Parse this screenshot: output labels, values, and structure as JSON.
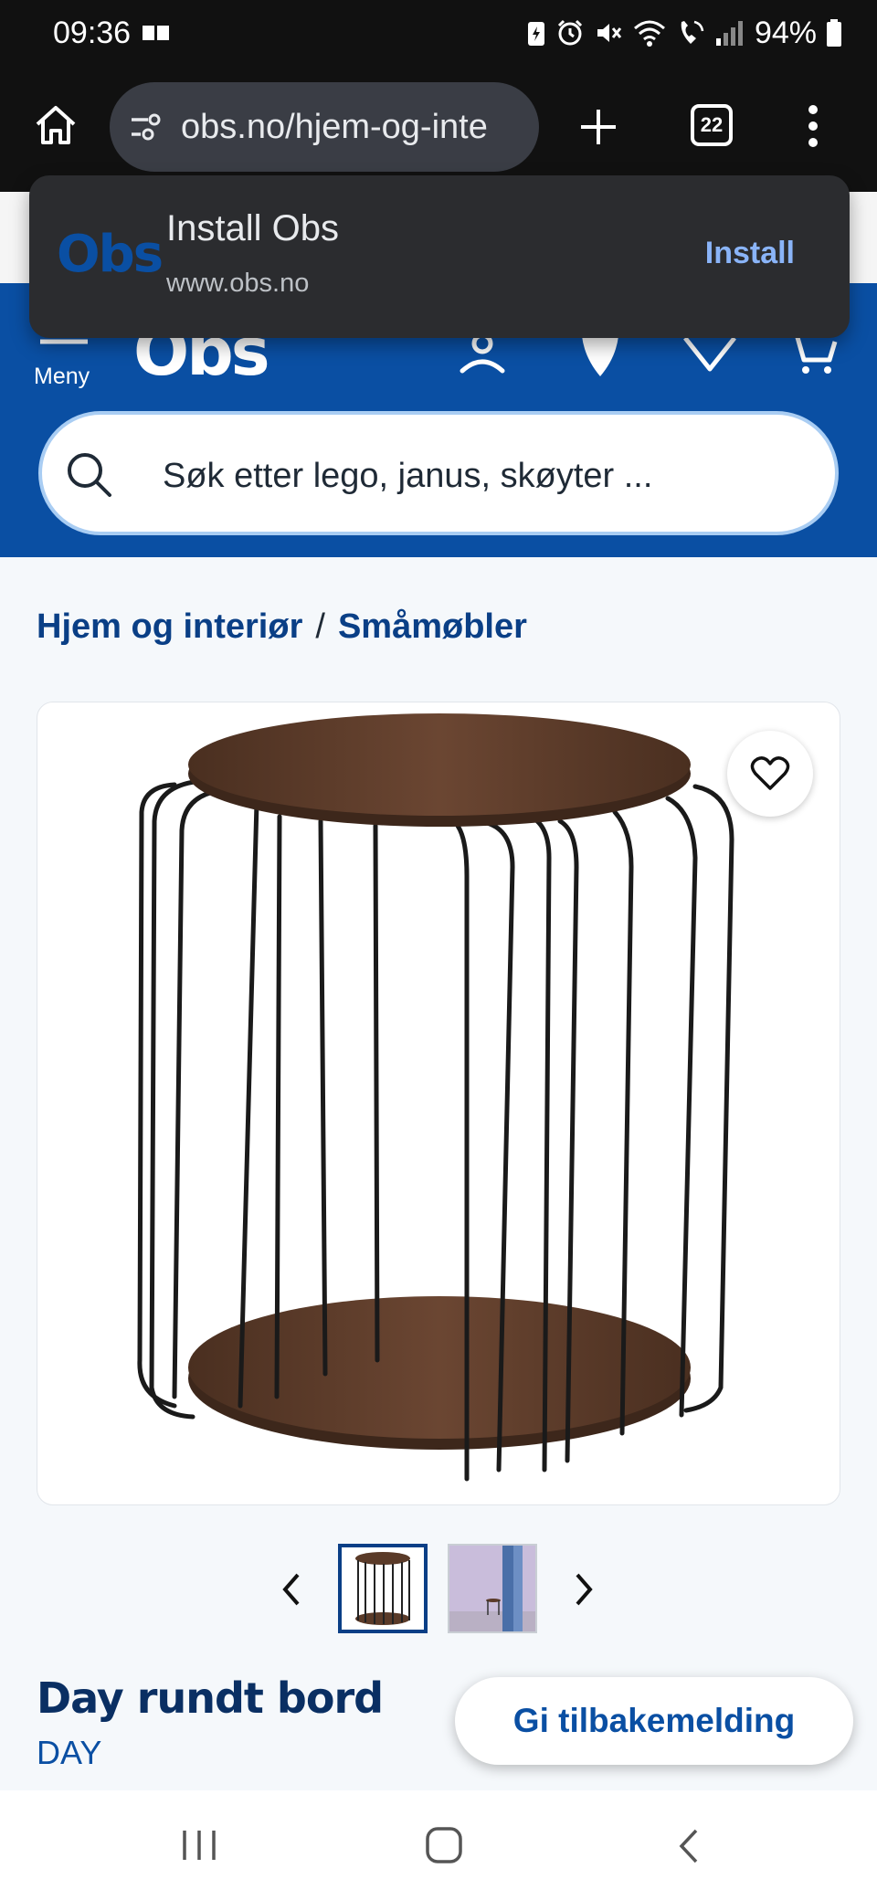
{
  "status": {
    "time": "09:36",
    "battery": "94%"
  },
  "browser": {
    "url": "obs.no/hjem-og-inte",
    "tab_count": "22"
  },
  "install_prompt": {
    "logo_text": "Obs",
    "title": "Install Obs",
    "domain": "www.obs.no",
    "install_label": "Install"
  },
  "header": {
    "menu_label": "Meny",
    "logo_text": "Obs",
    "search_placeholder": "Søk etter lego, janus, skøyter ..."
  },
  "breadcrumb": {
    "items": [
      "Hjem og interiør",
      "Småmøbler"
    ],
    "separator": "/"
  },
  "product": {
    "title": "Day rundt bord",
    "brand": "DAY",
    "thumbnails": [
      "table-photo",
      "room-photo"
    ],
    "selected_thumbnail": 0
  },
  "feedback": {
    "label": "Gi tilbakemelding"
  },
  "colors": {
    "brand_blue": "#0a4fa3",
    "dark_blue": "#0a2f63",
    "wood": "#5a3a28"
  }
}
